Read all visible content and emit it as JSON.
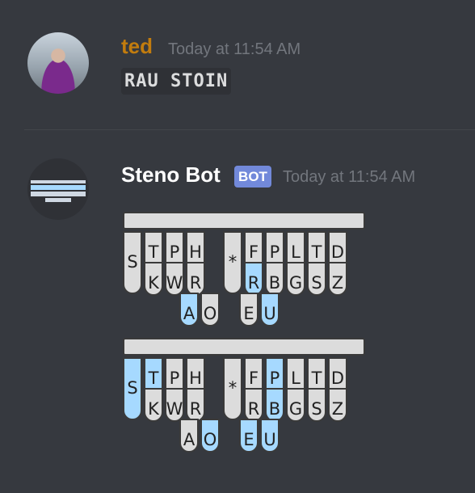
{
  "messages": [
    {
      "username": "ted",
      "username_color": "#c27c0e",
      "timestamp": "Today at 11:54 AM",
      "code": "RAU STOIN"
    },
    {
      "username": "Steno Bot",
      "username_color": "#ffffff",
      "badge": "BOT",
      "timestamp": "Today at 11:54 AM",
      "steno_strokes": [
        {
          "active_keys": [
            "-R",
            "A",
            "U"
          ]
        },
        {
          "active_keys": [
            "S",
            "T",
            "O",
            "E",
            "U",
            "-P",
            "-B"
          ]
        }
      ]
    }
  ],
  "steno_layout": {
    "left_top": [
      "T",
      "P",
      "H"
    ],
    "left_bottom": [
      "K",
      "W",
      "R"
    ],
    "left_tall": "S",
    "center": "*",
    "right_top": [
      "F",
      "P",
      "L",
      "T",
      "D"
    ],
    "right_bottom": [
      "R",
      "B",
      "G",
      "S",
      "Z"
    ],
    "vowels_left": [
      "A",
      "O"
    ],
    "vowels_right": [
      "E",
      "U"
    ]
  },
  "colors": {
    "active_key": "#a6d9ff",
    "inactive_key": "#dcdcdc"
  }
}
